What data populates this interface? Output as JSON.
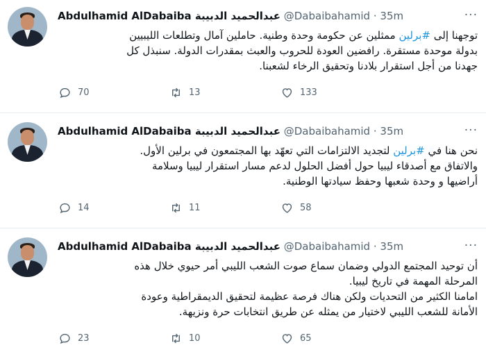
{
  "tweets": [
    {
      "name": "Abdulhamid AlDabaiba عبدالحميد الدبيبة",
      "handle": "@Dabaibahamid",
      "time": "· 35m",
      "body_line1_pre": "توجهنا إلى ",
      "hashtag": "#برلين",
      "body_line1_post": " ممثلين عن حكومة وحدة وطنية. حاملين آمال وتطلعات الليبيين",
      "body_rest": [
        "بدولة موحدة مستقرة. رافضين العودة للحروب والعبث بمقدرات الدولة. سنبذل كل",
        "جهدنا من أجل استقرار بلادنا وتحقيق الرخاء لشعبنا."
      ],
      "replies": "70",
      "retweets": "13",
      "likes": "133"
    },
    {
      "name": "Abdulhamid AlDabaiba عبدالحميد الدبيبة",
      "handle": "@Dabaibahamid",
      "time": "· 35m",
      "body_line1_pre": "نحن هنا في ",
      "hashtag": "#برلين",
      "body_line1_post": " لتجديد الالتزامات التي تعهّد بها المجتمعون في برلين الأول.",
      "body_rest": [
        "والاتفاق مع أصدقاء ليبيا حول أفضل الحلول لدعم مسار استقرار ليبيا وسلامة",
        "أراضيها و وحدة شعبها وحفظ سيادتها الوطنية."
      ],
      "replies": "14",
      "retweets": "11",
      "likes": "58"
    },
    {
      "name": "Abdulhamid AlDabaiba عبدالحميد الدبيبة",
      "handle": "@Dabaibahamid",
      "time": "· 35m",
      "body_line1_pre": "أن توحيد المجتمع الدولي وضمان سماع صوت الشعب الليبي أمر حيوي خلال هذه",
      "hashtag": "",
      "body_line1_post": "",
      "body_rest": [
        "المرحلة المهمة في تاريخ ليبيا.",
        "امامنا الكثير من التحديات ولكن هناك فرصة عظيمة لتحقيق الديمقراطية وعودة",
        "الأمانة للشعب الليبي لاختيار من يمثله عن طريق انتخابات حرة ونزيهة."
      ],
      "replies": "23",
      "retweets": "10",
      "likes": "65"
    }
  ],
  "icons": {
    "reply": "reply-icon",
    "retweet": "retweet-icon",
    "like": "like-icon",
    "more": "more-icon"
  },
  "colors": {
    "hashtag": "#1b95e0",
    "secondary": "#536471",
    "divider": "#e6ecf0"
  }
}
